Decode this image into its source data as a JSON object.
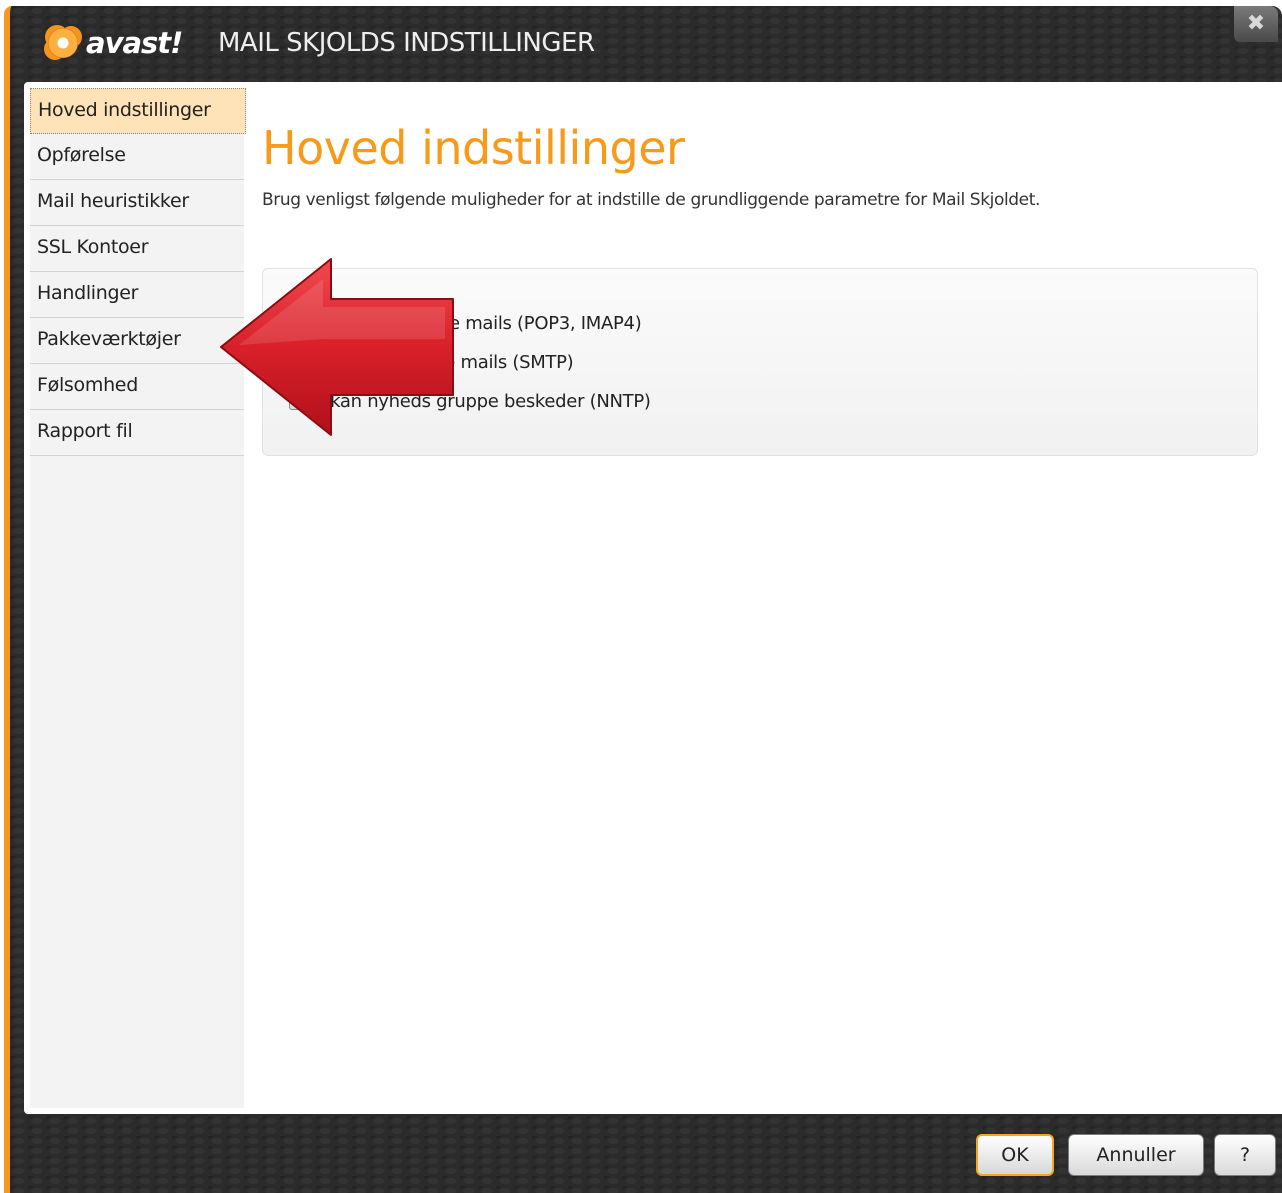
{
  "window": {
    "logo_text": "avast!",
    "title": "MAIL SKJOLDS INDSTILLINGER",
    "close_icon": "close-icon"
  },
  "sidebar": {
    "items": [
      {
        "label": "Hoved indstillinger",
        "active": true
      },
      {
        "label": "Opførelse"
      },
      {
        "label": "Mail heuristikker"
      },
      {
        "label": "SSL Kontoer"
      },
      {
        "label": "Handlinger"
      },
      {
        "label": "Pakkeværktøjer"
      },
      {
        "label": "Følsomhed"
      },
      {
        "label": "Rapport fil"
      }
    ]
  },
  "main": {
    "title": "Hoved indstillinger",
    "description": "Brug venligst følgende muligheder for at indstille de grundliggende parametre for Mail Skjoldet.",
    "options": [
      {
        "label": "Skan indgående mails (POP3, IMAP4)",
        "checked": true
      },
      {
        "label": "Skan udgående mails (SMTP)",
        "checked": true
      },
      {
        "label": "Skan nyheds gruppe beskeder (NNTP)",
        "checked": true
      }
    ]
  },
  "footer": {
    "ok_label": "OK",
    "cancel_label": "Annuller",
    "help_label": "?"
  },
  "colors": {
    "accent_orange": "#f79a1a",
    "arrow_red": "#d9202a",
    "active_item_bg": "#fde3b7"
  }
}
